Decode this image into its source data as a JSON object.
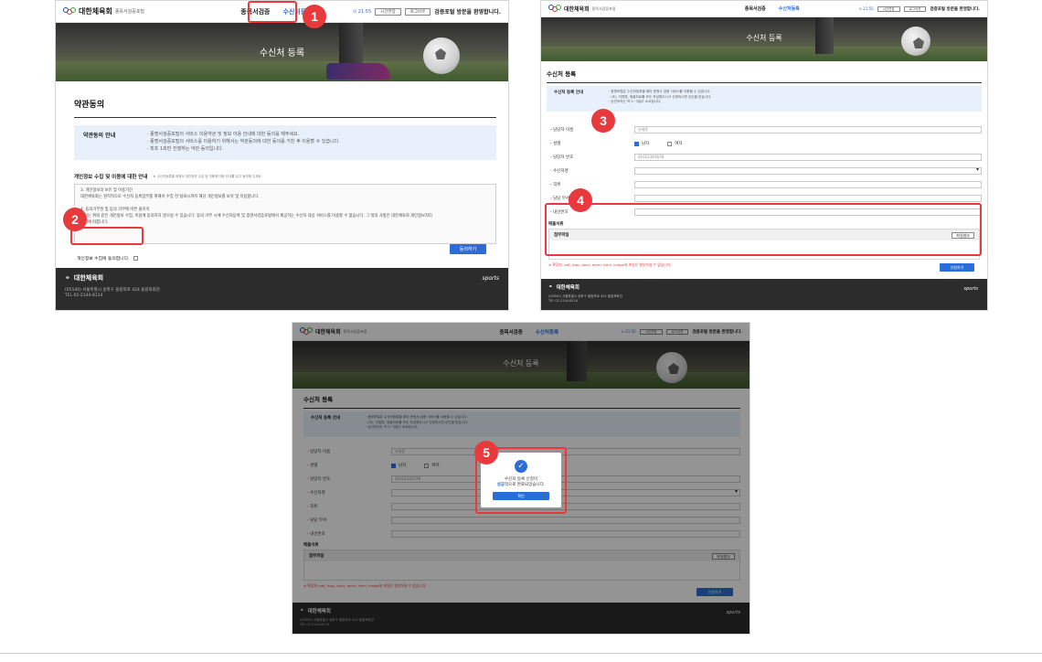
{
  "header": {
    "logo_text": "대한체육회",
    "logo_sub": "종목서검증포털",
    "nav": [
      "종목서검증",
      "수신처등록"
    ],
    "timer": "⊙ 21:55",
    "btn_extend": "시간연장",
    "btn_logout": "로그아웃",
    "welcome": "검증포털 방문을 환영합니다."
  },
  "hero_title": "수신처 등록",
  "step1": {
    "badge": "1",
    "badge2": "2",
    "section_title": "약관동의",
    "terms_label": "약관동의 안내",
    "terms_lines": [
      "· 종명서검증포털의 서비스 이용약관 및 정보 이용 안내에 대한 동의를 해주세요.",
      "· 종명서검증포털의 서비스를 이용하기 위해서는 약관동의에 대한 동의를 거친 후 이용할 수 있습니다.",
      "· 최초 1회만 진행하는 약관 동의입니다."
    ],
    "privacy_title": "개인정보 수집 및 이용에 대한 안내",
    "privacy_note": "※ 수신처등록을 위해서 개인정보 수집 및 이용에 대한 안내를 읽고 동의해 주세요.",
    "privacy_text": [
      "3. 개인정보의 보유 및 이용기간",
      "대한체육회는 원칙적으로 수신처 등록업무를 위해서 수집 한 탈퇴시까지 해당 개인정보를 보유 및 이용합니다.",
      "",
      "4. 동의거부권 및 동의 거부에 따른 불이익",
      "귀하는 위와 같은 개인정보 수집, 이용에 동의하지 않으실 수 있습니다. 동의 거부 시에 수신처등록 및 종명서검증포털에서 제공하는 수신처 대상 서비스를 이용할 수 없습니다. 그 밖의 사항은 대한체육회 개인정보처리",
      "방침에 따릅니다."
    ],
    "agree_label": "개인정보 수집에 동의합니다.",
    "agree_button": "동의하기"
  },
  "step2": {
    "badge3": "3",
    "badge4": "4",
    "section_title": "수신처 등록",
    "info_label": "수신처 등록 안내",
    "info_lines": [
      "· 종명포털은 수신처등록을 해야 문명서 검증 서비스를 이용할 수 있습니다.",
      "· (조), 지명명, 매출자료를 모두 작성해주시고 신청하시면 승인을 받습니다.",
      "· 승인까지는 약 2~3일이 소요됩니다."
    ],
    "fields": [
      {
        "label": "담당자 이름",
        "required": true,
        "value": "신재윤"
      },
      {
        "label": "성별",
        "required": true,
        "options": [
          "남자",
          "여자"
        ]
      },
      {
        "label": "담당자 번호",
        "required": true,
        "value": "01012345678"
      },
      {
        "label": "수신처명",
        "required": true,
        "value": ""
      },
      {
        "label": "직위",
        "required": true,
        "value": ""
      },
      {
        "label": "담당 부서",
        "required": true,
        "value": ""
      },
      {
        "label": "내선번호",
        "required": true,
        "value": ""
      }
    ],
    "attach_title": "매출서류",
    "attach_head": "첨부파일",
    "attach_button": "파일첨부",
    "attach_error": "※ 확장자: pdf, hwp, docx, excel, html, image외 파일은 첨부하실 수 없습니다.",
    "submit_button": "신청하기"
  },
  "step3": {
    "badge5": "5",
    "modal_line1": "수신처 등록 신청이",
    "modal_highlight": "성공",
    "modal_line2": "적으로 완료되었습니다.",
    "modal_button": "확인"
  },
  "footer": {
    "logo": "대한체육회",
    "line1": "(05540) 서울특별시 송파구 올림픽로 424 올림픽회관",
    "line2": "TEL 02-2144-8114",
    "right": "sports"
  },
  "colors": {
    "accent": "#2a6dd9",
    "marker": "#e8393c",
    "info_bg": "#e8f1fb"
  }
}
